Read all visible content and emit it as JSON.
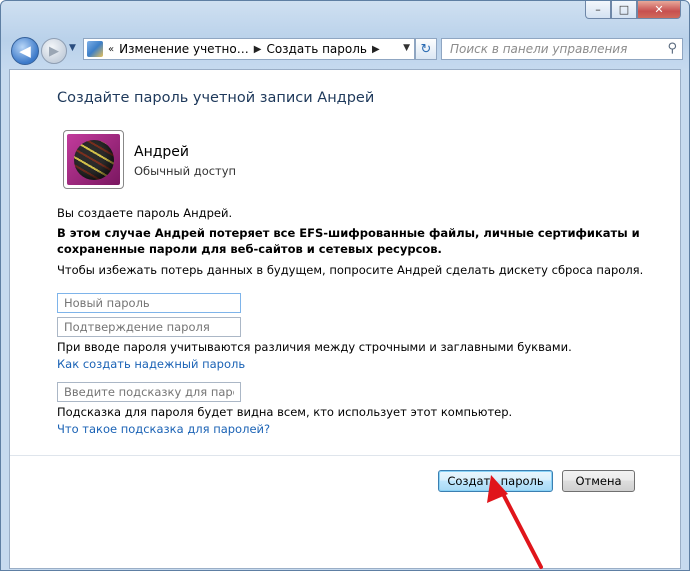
{
  "window": {
    "caption_buttons": {
      "minimize": "–",
      "maximize": "□",
      "close": "✕"
    }
  },
  "navbar": {
    "address_icon": "control-panel-icon",
    "breadcrumbs": [
      "Изменение учетно…",
      "Создать пароль"
    ],
    "overflow": "«",
    "search_placeholder": "Поиск в панели управления"
  },
  "main": {
    "title": "Создайте пароль учетной записи Андрей",
    "user": {
      "name": "Андрей",
      "type": "Обычный доступ"
    },
    "intro": "Вы создаете пароль Андрей.",
    "warning_line1": "В этом случае Андрей потеряет все EFS-шифрованные файлы, личные сертификаты и",
    "warning_line2": "сохраненные пароли для веб-сайтов и сетевых ресурсов.",
    "advice": "Чтобы избежать потерь данных в будущем, попросите Андрей сделать дискету сброса пароля.",
    "new_password_placeholder": "Новый пароль",
    "confirm_password_placeholder": "Подтверждение пароля",
    "case_note": "При вводе пароля учитываются различия между строчными и заглавными буквами.",
    "strong_password_link": "Как создать надежный пароль",
    "hint_placeholder": "Введите подсказку для пароля",
    "hint_note": "Подсказка для пароля будет видна всем, кто использует этот компьютер.",
    "hint_link": "Что такое подсказка для паролей?"
  },
  "buttons": {
    "create": "Создать пароль",
    "cancel": "Отмена"
  },
  "colors": {
    "title": "#1e395b",
    "link": "#1a62b5",
    "arrow": "#e0151b"
  }
}
